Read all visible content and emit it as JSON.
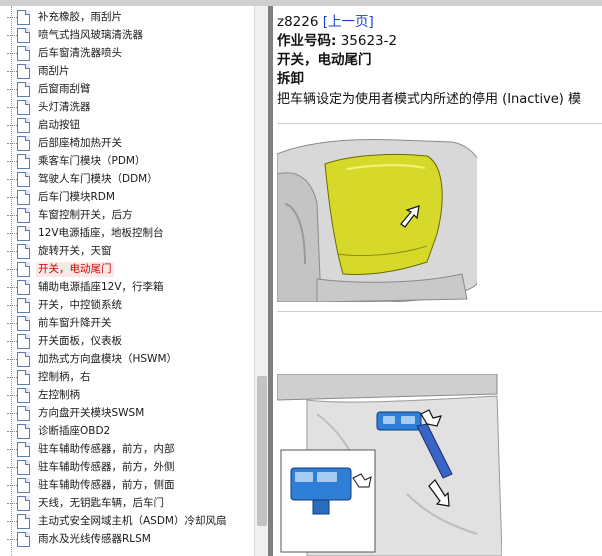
{
  "tree": {
    "items": [
      {
        "label": "补充橡胶，雨刮片",
        "selected": false
      },
      {
        "label": "喷气式挡风玻璃清洗器",
        "selected": false
      },
      {
        "label": "后车窗清洗器喷头",
        "selected": false
      },
      {
        "label": "雨刮片",
        "selected": false
      },
      {
        "label": "后窗雨刮臂",
        "selected": false
      },
      {
        "label": "头灯清洗器",
        "selected": false
      },
      {
        "label": "启动按钮",
        "selected": false
      },
      {
        "label": "后部座椅加热开关",
        "selected": false
      },
      {
        "label": "乘客车门模块（PDM）",
        "selected": false
      },
      {
        "label": "驾驶人车门模块（DDM）",
        "selected": false
      },
      {
        "label": "后车门模块RDM",
        "selected": false
      },
      {
        "label": "车窗控制开关，后方",
        "selected": false
      },
      {
        "label": "12V电源插座，地板控制台",
        "selected": false
      },
      {
        "label": "旋转开关，天窗",
        "selected": false
      },
      {
        "label": "开关，电动尾门",
        "selected": true
      },
      {
        "label": "辅助电源插座12V，行李箱",
        "selected": false
      },
      {
        "label": "开关，中控锁系统",
        "selected": false
      },
      {
        "label": "前车窗升降开关",
        "selected": false
      },
      {
        "label": "开关面板，仪表板",
        "selected": false
      },
      {
        "label": "加热式方向盘模块（HSWM）",
        "selected": false
      },
      {
        "label": "控制柄，右",
        "selected": false
      },
      {
        "label": "左控制柄",
        "selected": false
      },
      {
        "label": "方向盘开关模块SWSM",
        "selected": false
      },
      {
        "label": "诊断插座OBD2",
        "selected": false
      },
      {
        "label": "驻车辅助传感器，前方，内部",
        "selected": false
      },
      {
        "label": "驻车辅助传感器，前方，外侧",
        "selected": false
      },
      {
        "label": "驻车辅助传感器，前方，侧面",
        "selected": false
      },
      {
        "label": "天线，无钥匙车辆，后车门",
        "selected": false
      },
      {
        "label": "主动式安全网域主机（ASDM）冷却风扇",
        "selected": false
      },
      {
        "label": "雨水及光线传感器RLSM",
        "selected": false
      }
    ]
  },
  "content": {
    "doc_code": "z8226",
    "prev_link": "[上一页]",
    "op_number_label": "作业号码:",
    "op_number_value": "35623-2",
    "title": "开关，电动尾门",
    "section": "拆卸",
    "instruction": "把车辆设定为使用者模式内所述的停用 (Inactive) 模"
  },
  "colors": {
    "highlight_yellow": "#d7d92a",
    "switch_blue": "#2f7fd6",
    "selected_text": "#d00000",
    "link_blue": "#1a3fd0"
  }
}
